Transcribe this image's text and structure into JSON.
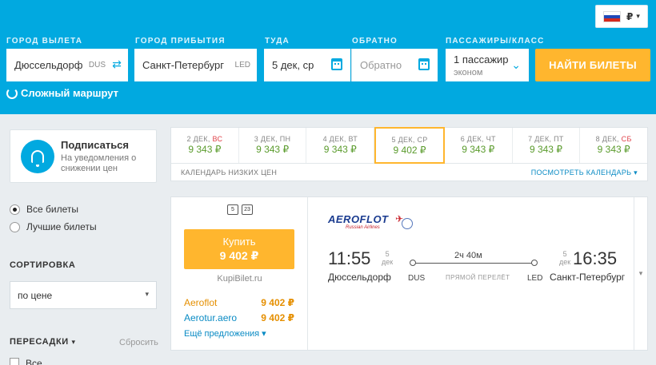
{
  "header": {
    "currency": "₽",
    "labels": {
      "origin": "ГОРОД ВЫЛЕТА",
      "destination": "ГОРОД ПРИБЫТИЯ",
      "depart": "ТУДА",
      "return": "ОБРАТНО",
      "passengers": "ПАССАЖИРЫ/КЛАСС"
    },
    "origin_value": "Дюссельдорф",
    "origin_code": "DUS",
    "destination_value": "Санкт-Петербург",
    "destination_code": "LED",
    "depart_value": "5 дек, ср",
    "return_placeholder": "Обратно",
    "passengers_value": "1 пассажир",
    "class_value": "эконом",
    "search_button": "НАЙТИ БИЛЕТЫ",
    "complex_route": "Сложный маршрут"
  },
  "sidebar": {
    "subscribe_title": "Подписаться",
    "subscribe_desc": "На уведомления о снижении цен",
    "radio_all": "Все билеты",
    "radio_best": "Лучшие билеты",
    "sort_title": "СОРТИРОВКА",
    "sort_value": "по цене",
    "stops_title": "ПЕРЕСАДКИ",
    "reset": "Сбросить",
    "all_label": "Все"
  },
  "calendar": {
    "days": [
      {
        "date": "2 ДЕК,",
        "weekday": "ВС",
        "weekend": true,
        "price": "9 343 ₽"
      },
      {
        "date": "3 ДЕК,",
        "weekday": "ПН",
        "weekend": false,
        "price": "9 343 ₽"
      },
      {
        "date": "4 ДЕК,",
        "weekday": "ВТ",
        "weekend": false,
        "price": "9 343 ₽"
      },
      {
        "date": "5 ДЕК,",
        "weekday": "СР",
        "weekend": false,
        "price": "9 402 ₽"
      },
      {
        "date": "6 ДЕК,",
        "weekday": "ЧТ",
        "weekend": false,
        "price": "9 343 ₽"
      },
      {
        "date": "7 ДЕК,",
        "weekday": "ПТ",
        "weekend": false,
        "price": "9 343 ₽"
      },
      {
        "date": "8 ДЕК,",
        "weekday": "СБ",
        "weekend": true,
        "price": "9 343 ₽"
      }
    ],
    "footer_left": "КАЛЕНДАРЬ НИЗКИХ ЦЕН",
    "footer_right": "ПОСМОТРЕТЬ КАЛЕНДАРЬ ▾"
  },
  "ticket": {
    "bag1": "5",
    "bag2": "23",
    "buy_label": "Купить",
    "buy_price": "9 402 ₽",
    "agency": "KupiBilet.ru",
    "offers": [
      {
        "name": "Aeroflot",
        "price": "9 402 ₽"
      },
      {
        "name": "Aerotur.aero",
        "price": "9 402 ₽"
      }
    ],
    "more_offers": "Ещё предложения ▾",
    "airline": "AEROFLOT",
    "airline_sub": "Russian Airlines",
    "depart_time": "11:55",
    "depart_day": "5",
    "depart_month": "дек",
    "arrive_time": "16:35",
    "arrive_day": "5",
    "arrive_month": "дек",
    "depart_city": "Дюссельдорф",
    "arrive_city": "Санкт-Петербург",
    "duration": "2ч 40м",
    "from_code": "DUS",
    "to_code": "LED",
    "direct": "ПРЯМОЙ ПЕРЕЛЁТ"
  },
  "colors": {
    "header_bg": "#01a9e0",
    "accent_orange": "#ffb62e",
    "price_green": "#5a9b2c",
    "link_blue": "#0a8bc4"
  }
}
